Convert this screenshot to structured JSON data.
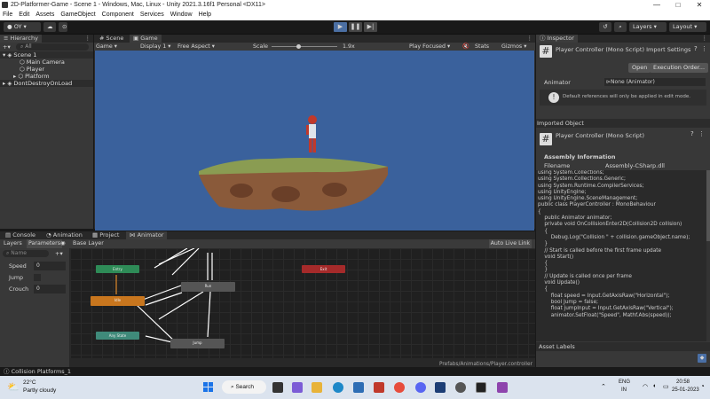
{
  "window": {
    "title": "2D-Platformer-Game - Scene 1 - Windows, Mac, Linux - Unity 2021.3.16f1 Personal <DX11>",
    "min": "—",
    "max": "□",
    "close": "✕"
  },
  "menu": [
    "File",
    "Edit",
    "Assets",
    "GameObject",
    "Component",
    "Services",
    "Window",
    "Help"
  ],
  "toolbar": {
    "account": "OY ▾",
    "layers": "Layers",
    "layout": "Layout"
  },
  "hierarchy": {
    "tab": "Hierarchy",
    "search": "All",
    "scene": "Scene 1",
    "items": [
      "Main Camera",
      "Player",
      "Platform"
    ],
    "dontdestroy": "DontDestroyOnLoad"
  },
  "scene_tabs": {
    "scene": "Scene",
    "game": "Game"
  },
  "game_bar": {
    "mode": "Game",
    "display": "Display 1",
    "aspect": "Free Aspect",
    "scale_label": "Scale",
    "scale_value": "1.9x",
    "play_focused": "Play Focused",
    "stats": "Stats",
    "gizmos": "Gizmos"
  },
  "bottom_tabs": [
    "Console",
    "Animation",
    "Project",
    "Animator"
  ],
  "animator": {
    "layers": "Layers",
    "parameters": "Parameters",
    "base_layer": "Base Layer",
    "auto_live": "Auto Live Link",
    "search": "Name",
    "params": [
      {
        "name": "Speed",
        "value": "0"
      },
      {
        "name": "Jump",
        "value": ""
      },
      {
        "name": "Crouch",
        "value": "0"
      }
    ],
    "path": "Prefabs/Animations/Player.controller",
    "nodes": {
      "entry": "Entry",
      "exit": "Exit",
      "idle": "Idle",
      "run": "Run",
      "any": "Any State",
      "jump": "Jump"
    }
  },
  "status_bar": "Collision Platforms_1",
  "inspector": {
    "tab": "Inspector",
    "title": "Player Controller (Mono Script) Import Settings",
    "open": "Open",
    "exec_order": "Execution Order...",
    "animator_label": "Animator",
    "animator_value": "None (Animator)",
    "warning": "Default references will only be applied in edit mode.",
    "imported": "Imported Object",
    "script_name": "Player Controller (Mono Script)",
    "assembly_header": "Assembly Information",
    "filename_label": "Filename",
    "filename_value": "Assembly-CSharp.dll",
    "asset_labels": "Asset Labels",
    "code": [
      "using System.Collections;",
      "using System.Collections.Generic;",
      "using System.Runtime.CompilerServices;",
      "using UnityEngine;",
      "using UnityEngine.SceneManagement;",
      "",
      "public class PlayerController : MonoBehaviour",
      "{",
      "    public Animator animator;",
      "    private void OnCollisionEnter2D(Collision2D collision)",
      "    {",
      "        Debug.Log(\"Collision \" + collision.gameObject.name);",
      "    }",
      "    // Start is called before the first frame update",
      "    void Start()",
      "    {",
      "",
      "    }",
      "",
      "    // Update is called once per frame",
      "    void Update()",
      "    {",
      "        float speed = Input.GetAxisRaw(\"Horizontal\");",
      "        bool Jump = false;",
      "        float jumpInput = Input.GetAxisRaw(\"Vertical\");",
      "        animator.SetFloat(\"Speed\", Mathf.Abs(speed));"
    ]
  },
  "taskbar": {
    "temp": "22°C",
    "weather": "Partly cloudy",
    "search": "Search",
    "lang": "ENG",
    "region": "IN",
    "time": "20:58",
    "date": "25-01-2023"
  }
}
